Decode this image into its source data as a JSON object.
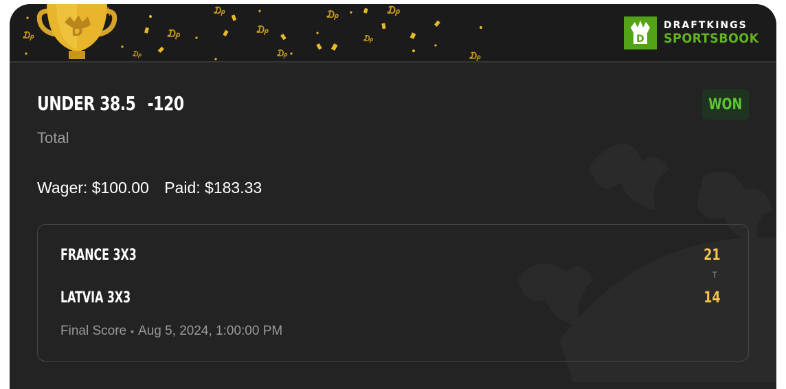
{
  "brand": {
    "line1": "DRAFTKINGS",
    "line2": "SPORTSBOOK",
    "color": "#53a318"
  },
  "bet": {
    "selection": "UNDER 38.5",
    "odds": "-120",
    "market": "Total",
    "status": "WON",
    "wager_label": "Wager:",
    "wager_amount": "$100.00",
    "paid_label": "Paid:",
    "paid_amount": "$183.33"
  },
  "game": {
    "teams": [
      {
        "name": "FRANCE 3X3",
        "score": "21"
      },
      {
        "name": "LATVIA 3X3",
        "score": "14"
      }
    ],
    "period": "T",
    "status_label": "Final Score",
    "datetime": "Aug 5, 2024, 1:00:00 PM"
  },
  "colors": {
    "background": "#232323",
    "won": "#5cc72f",
    "score": "#f2c24f",
    "muted": "#9a9a9a"
  }
}
